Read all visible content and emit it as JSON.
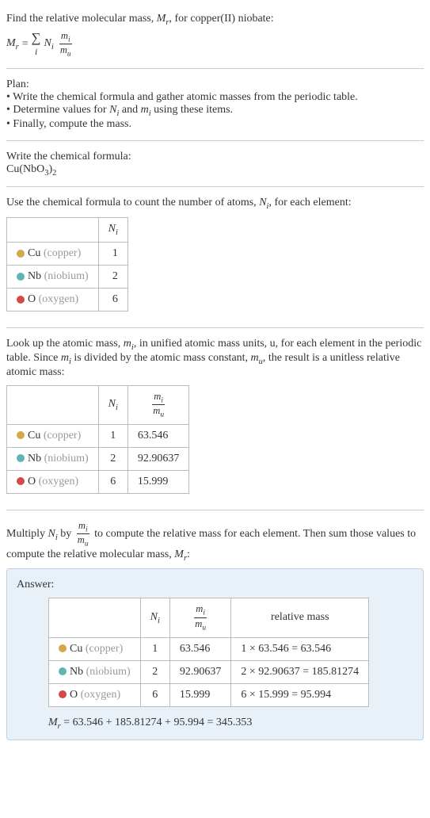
{
  "intro": {
    "line1": "Find the relative molecular mass, ",
    "line1b": ", for copper(II) niobate:",
    "mr": "M",
    "mr_sub": "r",
    "equals": " = ",
    "sigma_sub": "i",
    "ni": "N",
    "ni_sub": "i",
    "mi": "m",
    "mi_sub": "i",
    "mu": "m",
    "mu_sub": "u"
  },
  "plan": {
    "title": "Plan:",
    "items": [
      "Write the chemical formula and gather atomic masses from the periodic table.",
      "Determine values for Nᵢ and mᵢ using these items.",
      "Finally, compute the mass."
    ],
    "item1": "Write the chemical formula and gather atomic masses from the periodic table.",
    "item2a": "Determine values for ",
    "item2b": " and ",
    "item2c": " using these items.",
    "item3": "Finally, compute the mass."
  },
  "formula_section": {
    "title": "Write the chemical formula:",
    "formula": "Cu(NbO",
    "sub3": "3",
    "close": ")",
    "sub2": "2"
  },
  "count_section": {
    "intro1": "Use the chemical formula to count the number of atoms, ",
    "intro2": ", for each element:"
  },
  "table1": {
    "header_ni": "N",
    "header_ni_sub": "i",
    "rows": [
      {
        "symbol": "Cu",
        "name": "(copper)",
        "n": "1",
        "dot": "dot-cu"
      },
      {
        "symbol": "Nb",
        "name": "(niobium)",
        "n": "2",
        "dot": "dot-nb"
      },
      {
        "symbol": "O",
        "name": "(oxygen)",
        "n": "6",
        "dot": "dot-o"
      }
    ]
  },
  "lookup_section": {
    "text1": "Look up the atomic mass, ",
    "text2": ", in unified atomic mass units, u, for each element in the periodic table. Since ",
    "text3": " is divided by the atomic mass constant, ",
    "text4": ", the result is a unitless relative atomic mass:"
  },
  "table2": {
    "rows": [
      {
        "symbol": "Cu",
        "name": "(copper)",
        "n": "1",
        "m": "63.546",
        "dot": "dot-cu"
      },
      {
        "symbol": "Nb",
        "name": "(niobium)",
        "n": "2",
        "m": "92.90637",
        "dot": "dot-nb"
      },
      {
        "symbol": "O",
        "name": "(oxygen)",
        "n": "6",
        "m": "15.999",
        "dot": "dot-o"
      }
    ]
  },
  "multiply_section": {
    "text1": "Multiply ",
    "text2": " by ",
    "text3": " to compute the relative mass for each element. Then sum those values to compute the relative molecular mass, ",
    "text4": ":"
  },
  "answer": {
    "title": "Answer:",
    "table": {
      "header_rel": "relative mass",
      "rows": [
        {
          "symbol": "Cu",
          "name": "(copper)",
          "n": "1",
          "m": "63.546",
          "rel": "1 × 63.546 = 63.546",
          "dot": "dot-cu"
        },
        {
          "symbol": "Nb",
          "name": "(niobium)",
          "n": "2",
          "m": "92.90637",
          "rel": "2 × 92.90637 = 185.81274",
          "dot": "dot-nb"
        },
        {
          "symbol": "O",
          "name": "(oxygen)",
          "n": "6",
          "m": "15.999",
          "rel": "6 × 15.999 = 95.994",
          "dot": "dot-o"
        }
      ]
    },
    "final": " = 63.546 + 185.81274 + 95.994 = 345.353"
  },
  "chart_data": {
    "type": "table",
    "title": "Relative molecular mass calculation for copper(II) niobate Cu(NbO3)2",
    "elements": [
      {
        "element": "Cu",
        "name": "copper",
        "N_i": 1,
        "m_i_over_m_u": 63.546,
        "relative_mass": 63.546
      },
      {
        "element": "Nb",
        "name": "niobium",
        "N_i": 2,
        "m_i_over_m_u": 92.90637,
        "relative_mass": 185.81274
      },
      {
        "element": "O",
        "name": "oxygen",
        "N_i": 6,
        "m_i_over_m_u": 15.999,
        "relative_mass": 95.994
      }
    ],
    "M_r": 345.353
  }
}
